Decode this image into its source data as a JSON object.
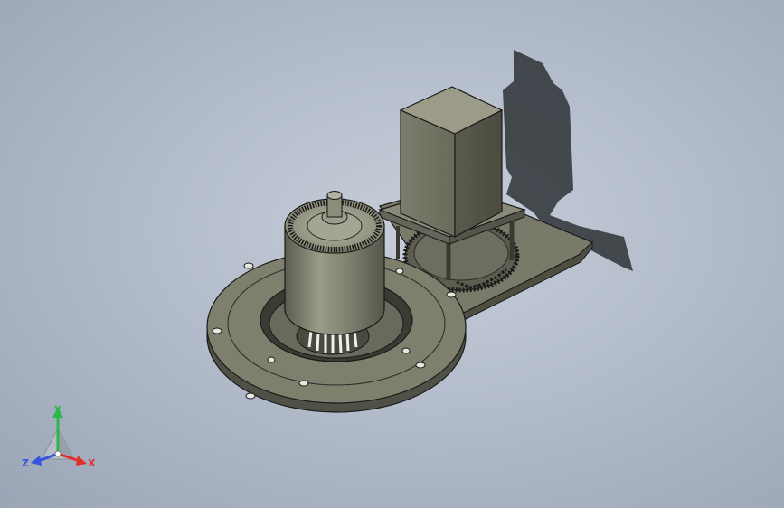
{
  "viewport": {
    "background_center": "#c7ced9",
    "background_edge": "#9aa5b6"
  },
  "model": {
    "parts": [
      "base-plate",
      "ring-flange",
      "slip-ring-cylinder",
      "bevel-gear",
      "spur-gear",
      "motor-mount-plate",
      "stepper-motor-box",
      "shadow"
    ],
    "body_color": "#6e6e60",
    "highlight_color": "#8d8d7d",
    "edge_color": "#1a1a1a"
  },
  "triad": {
    "x_label": "X",
    "y_label": "Y",
    "z_label": "Z",
    "x_color": "#e0302a",
    "y_color": "#2fb84a",
    "z_color": "#3355dd"
  }
}
